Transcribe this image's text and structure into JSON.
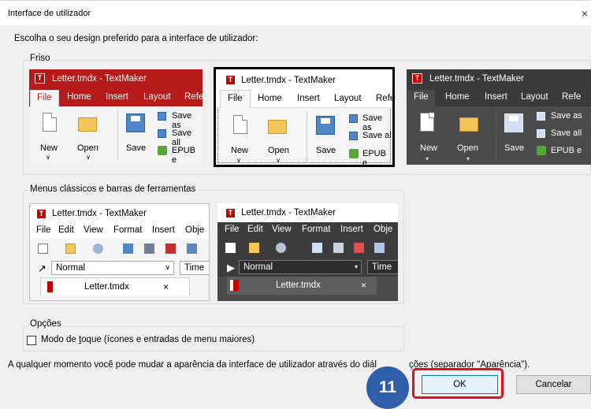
{
  "dialog": {
    "title": "Interface de utilizador",
    "close_glyph": "×",
    "prompt": "Escolha o seu design preferido para a interface de utilizador:"
  },
  "ribbon_group": {
    "label": "Friso",
    "previews": [
      {
        "theme": "red",
        "title_text": "Letter.tmdx - TextMaker",
        "tabs": [
          "File",
          "Home",
          "Insert",
          "Layout",
          "Refe"
        ],
        "buttons": {
          "new": "New",
          "open": "Open",
          "save": "Save",
          "save_as": "Save as",
          "save_all": "Save all",
          "epub": "EPUB e"
        }
      },
      {
        "theme": "white",
        "selected": true,
        "title_text": "Letter.tmdx - TextMaker",
        "tabs": [
          "File",
          "Home",
          "Insert",
          "Layout",
          "Refe"
        ],
        "buttons": {
          "new": "New",
          "open": "Open",
          "save": "Save",
          "save_as": "Save as",
          "save_all": "Save al",
          "epub": "EPUB e"
        }
      },
      {
        "theme": "dark",
        "title_text": "Letter.tmdx - TextMaker",
        "tabs": [
          "File",
          "Home",
          "Insert",
          "Layout",
          "Refe"
        ],
        "buttons": {
          "new": "New",
          "open": "Open",
          "save": "Save",
          "save_as": "Save as",
          "save_all": "Save all",
          "epub": "EPUB e"
        }
      }
    ]
  },
  "classic_group": {
    "label": "Menus clássicos e barras de ferramentas",
    "previews": [
      {
        "theme": "light",
        "title_text": "Letter.tmdx - TextMaker",
        "menu": [
          "File",
          "Edit",
          "View",
          "Format",
          "Insert",
          "Obje"
        ],
        "style_value": "Normal",
        "font_value": "Time",
        "doc_tab": "Letter.tmdx",
        "doc_close": "×"
      },
      {
        "theme": "dark",
        "title_text": "Letter.tmdx - TextMaker",
        "menu": [
          "File",
          "Edit",
          "View",
          "Format",
          "Insert",
          "Obje"
        ],
        "style_value": "Normal",
        "font_value": "Time",
        "doc_tab": "Letter.tmdx",
        "doc_close": "×"
      }
    ]
  },
  "options_group": {
    "label": "Opções",
    "touch_mode_label_pre": "Modo de ",
    "touch_mode_label_u": "t",
    "touch_mode_label_post": "oque (ícones e entradas de menu maiores)",
    "touch_mode_checked": false
  },
  "info_text": "A qualquer momento você pode mudar a aparência da interface de utilizador através do diál",
  "info_text_tail": "ções (separador \"Aparência\").",
  "buttons": {
    "ok": "OK",
    "cancel": "Cancelar"
  },
  "step_badge": "11",
  "colors": {
    "accent_red": "#c40000",
    "badge_blue": "#2f5fa8",
    "highlight_red": "#e01020"
  }
}
